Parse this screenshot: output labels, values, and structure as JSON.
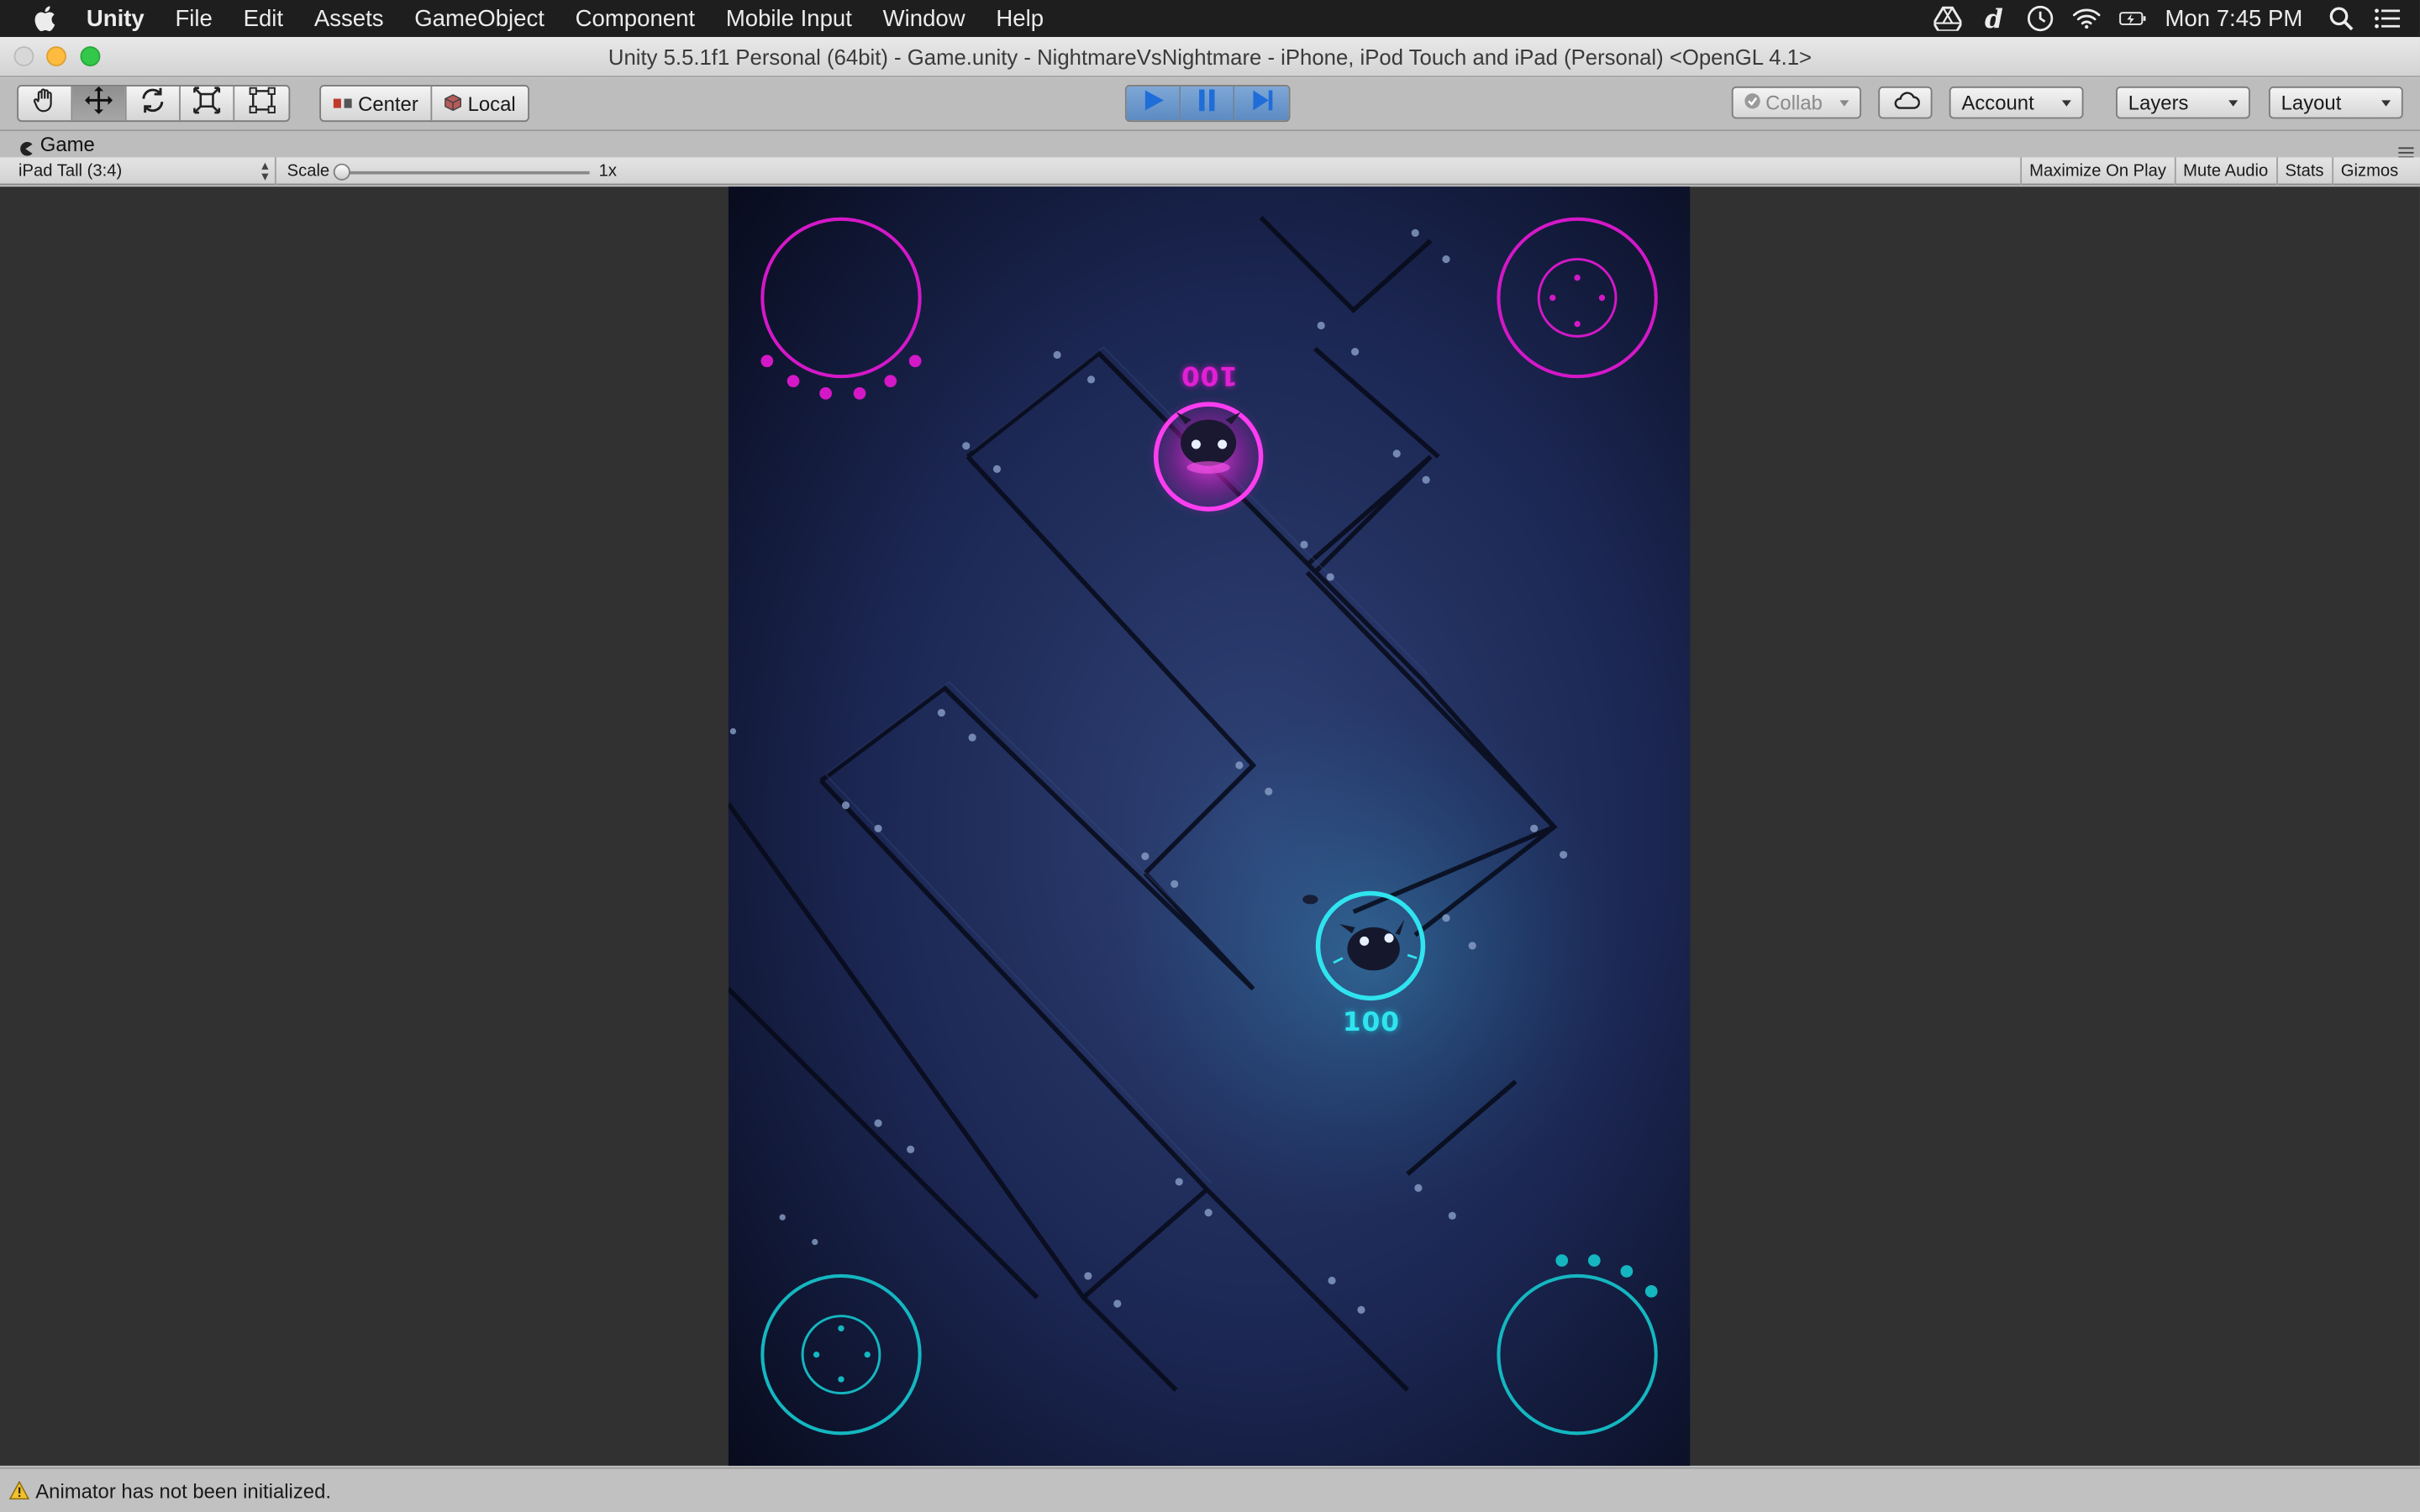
{
  "menubar": {
    "app": "Unity",
    "items": [
      "File",
      "Edit",
      "Assets",
      "GameObject",
      "Component",
      "Mobile Input",
      "Window",
      "Help"
    ],
    "clock": "Mon 7:45 PM"
  },
  "window": {
    "title": "Unity 5.5.1f1 Personal (64bit) - Game.unity - NightmareVsNightmare - iPhone, iPod Touch and iPad (Personal) <OpenGL 4.1>"
  },
  "toolbar": {
    "tools": [
      "hand-tool",
      "move-tool",
      "rotate-tool",
      "scale-tool",
      "rect-tool"
    ],
    "pivot_label": "Center",
    "space_label": "Local",
    "collab_label": "Collab",
    "account_label": "Account",
    "layers_label": "Layers",
    "layout_label": "Layout"
  },
  "game_panel": {
    "tab_label": "Game",
    "resolution": "iPad Tall (3:4)",
    "scale_label": "Scale",
    "scale_value": "1x",
    "buttons": [
      "Maximize On Play",
      "Mute Audio",
      "Stats",
      "Gizmos"
    ]
  },
  "game": {
    "player1_score": "100",
    "player2_score": "100",
    "player1_color": "#e21fd5",
    "player2_color": "#2fe4ef"
  },
  "status": {
    "message": "Animator has not been initialized."
  }
}
